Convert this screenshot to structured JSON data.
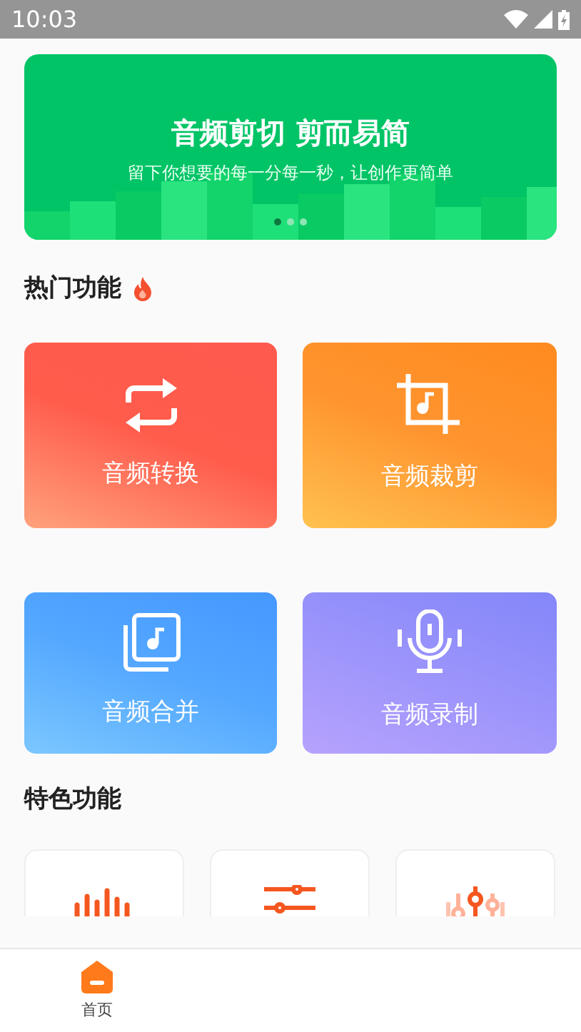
{
  "status_bar": {
    "time": "10:03"
  },
  "banner": {
    "title": "音频剪切 剪而易简",
    "subtitle": "留下你想要的每一分每一秒，让创作更简单",
    "dots": [
      {
        "selected": true
      },
      {
        "selected": false
      },
      {
        "selected": false
      }
    ]
  },
  "hot_section": {
    "title": "热门功能",
    "items": [
      {
        "kind": "convert",
        "label": "音频转换"
      },
      {
        "kind": "crop",
        "label": "音频裁剪"
      },
      {
        "kind": "merge",
        "label": "音频合并"
      },
      {
        "kind": "record",
        "label": "音频录制"
      }
    ]
  },
  "featured_section": {
    "title": "特色功能",
    "items": [
      {
        "kind": "waveform"
      },
      {
        "kind": "sliders"
      },
      {
        "kind": "equalizer"
      }
    ]
  },
  "bottom_nav": [
    {
      "label": "首页",
      "selected": true
    }
  ]
}
